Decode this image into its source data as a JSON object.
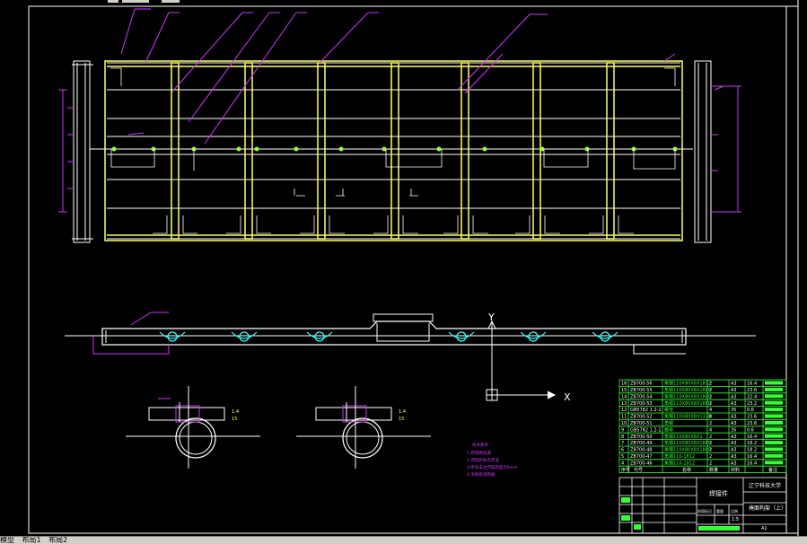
{
  "layout_tabs": [
    "模型",
    "布局1",
    "布局2"
  ],
  "axis": {
    "x": "X",
    "y": "Y"
  },
  "detail_labels": [
    {
      "name": "1:4",
      "scale": "15"
    },
    {
      "name": "1:4",
      "scale": "15"
    }
  ],
  "notes": {
    "title": "技术要求",
    "lines": [
      "1.焊缝要饱满",
      "2.焊接后除去焊渣",
      "3.所有未注焊缝高度均6mm",
      "4.涂防锈漆两遍"
    ]
  },
  "bom_rows": [
    {
      "no": "16",
      "code": "ZB700-56",
      "name": "角钢110X80X8X1812",
      "qty": "2",
      "mat": "A3",
      "mass": "16.4"
    },
    {
      "no": "15",
      "code": "ZB700-55",
      "name": "角钢110X80X8X1880",
      "qty": "2",
      "mat": "A3",
      "mass": "23.6"
    },
    {
      "no": "14",
      "code": "ZB700-54",
      "name": "角钢110X80X8X1880",
      "qty": "2",
      "mat": "A3",
      "mass": "22.4"
    },
    {
      "no": "13",
      "code": "ZB700-53",
      "name": "角钢110X80X8X1880",
      "qty": "2",
      "mat": "A3",
      "mass": "23.2"
    },
    {
      "no": "12",
      "code": "GB5782 1.2-1",
      "name": "螺栓",
      "qty": "4",
      "mat": "35",
      "mass": "0.6"
    },
    {
      "no": "11",
      "code": "ZB700-52",
      "name": "角钢110X80X8X1378",
      "qty": "8",
      "mat": "A3",
      "mass": "23.6"
    },
    {
      "no": "10",
      "code": "ZB700-51",
      "name": "角钢",
      "qty": "2",
      "mat": "A3",
      "mass": "23.6"
    },
    {
      "no": "9",
      "code": "GB5782 1.2-1",
      "name": "螺母",
      "qty": "4",
      "mat": "35",
      "mass": "0.6"
    },
    {
      "no": "8",
      "code": "ZB700-50",
      "name": "角钢110X80X8X1",
      "qty": "2",
      "mat": "A3",
      "mass": "16.4"
    },
    {
      "no": "7",
      "code": "ZB700-49",
      "name": "角钢110X80X8X1880",
      "qty": "2",
      "mat": "A3",
      "mass": "18.2"
    },
    {
      "no": "6",
      "code": "ZB700-48",
      "name": "角钢110X80X8X1880",
      "qty": "2",
      "mat": "A3",
      "mass": "18.2"
    },
    {
      "no": "5",
      "code": "ZB700-47",
      "name": "角钢110-1812",
      "qty": "2",
      "mat": "A3",
      "mass": "16.4"
    },
    {
      "no": "4",
      "code": "ZB700-46",
      "name": "角钢110-1812",
      "qty": "2",
      "mat": "A3",
      "mass": "16.4"
    }
  ],
  "bom_header": [
    "序号",
    "代号",
    "名称",
    "数量",
    "材料",
    "备注"
  ],
  "title_block": {
    "part_type": "焊接件",
    "university": "辽宁科技大学",
    "drawing_title": "掩面构架（上）",
    "scale": "1:5",
    "sheet": "A1",
    "stage_label": "阶段标记",
    "weight_label": "重量",
    "ratio_label": "比例"
  },
  "colors": {
    "frame_yellow": "#ffff66",
    "line_white": "#ffffff",
    "leader_magenta": "#cc33ff",
    "table_green": "#33ff33",
    "accent_cyan": "#33ffff",
    "lime": "#99ff33"
  }
}
